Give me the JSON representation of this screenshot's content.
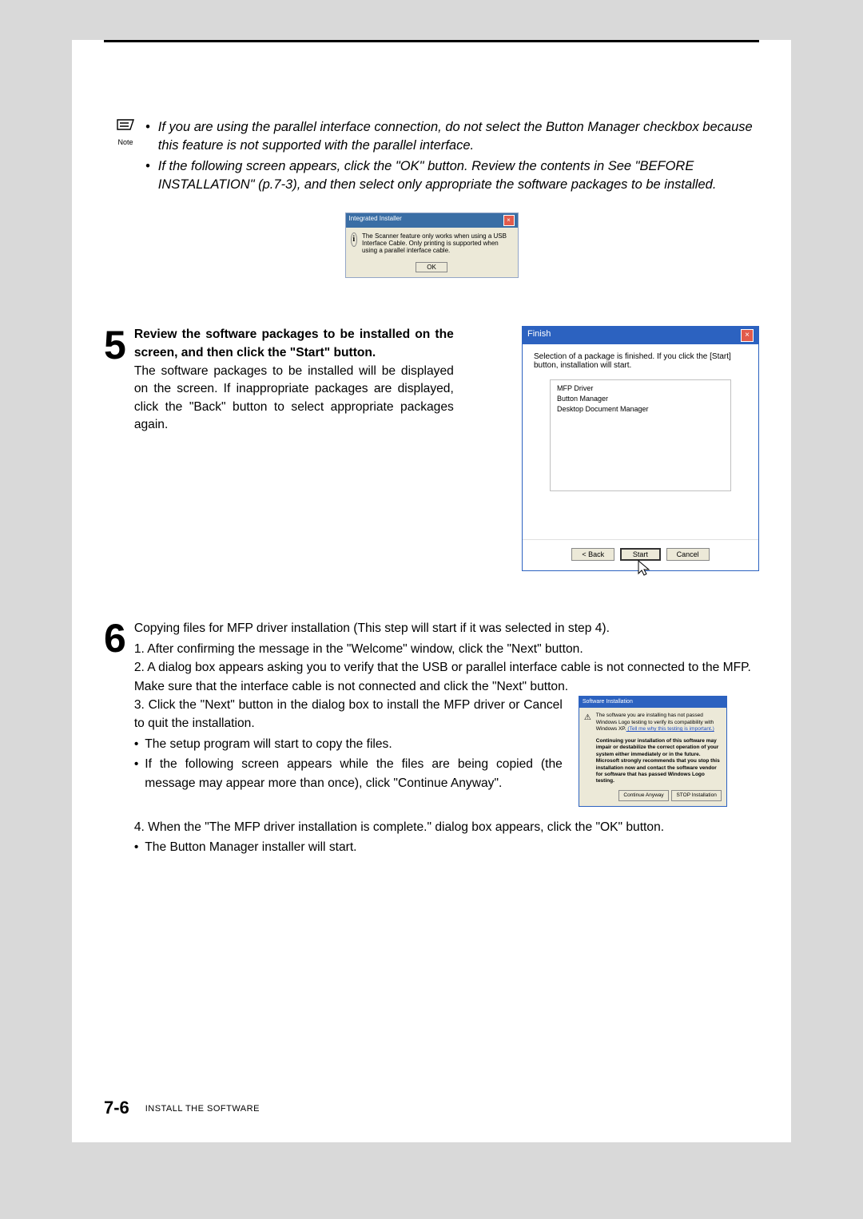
{
  "note": {
    "label": "Note",
    "bullets": [
      "If you are using the parallel interface connection, do not select the Button Manager checkbox because this feature is not supported with the parallel interface.",
      "If the following screen appears, click the \"OK\" button. Review the contents in See \"BEFORE INSTALLATION\" (p.7-3), and then select only appropriate the software packages to be installed."
    ]
  },
  "dialog1": {
    "title": "Integrated Installer",
    "msg": "The Scanner feature only works when using a USB Interface Cable. Only printing is supported when using a parallel interface cable.",
    "ok": "OK"
  },
  "step5": {
    "num": "5",
    "p1": "Review the software packages to be installed on the screen, and then click the \"Start\" button.",
    "p2": "The software packages to be installed will be displayed on the screen. If inappropriate packages are displayed, click the \"Back\" button to select appropriate packages again."
  },
  "finish": {
    "title": "Finish",
    "msg": "Selection of a package is finished. If you click the [Start] button, installation will start.",
    "items": [
      "MFP Driver",
      "Button Manager",
      "Desktop Document Manager"
    ],
    "back": "< Back",
    "start": "Start",
    "cancel": "Cancel"
  },
  "step6": {
    "num": "6",
    "lead": "Copying files for MFP driver installation (This step will start if it was selected in step 4).",
    "li1": "After confirming the message in the \"Welcome\" window, click the \"Next\" button.",
    "li2": "A dialog box appears asking you to verify that the USB or parallel interface cable is not connected to the MFP. Make sure that the interface cable is not connected and click the \"Next\" button.",
    "li3": "Click the \"Next\" button in the dialog box to install the MFP driver or Cancel to quit the installation.",
    "b1": "The setup program will start to copy the files.",
    "b2": "If the following screen appears while the files are being copied (the message may appear more than once), click \"Continue Anyway\".",
    "li4": "When the \"The MFP driver installation is complete.\" dialog box appears, click the \"OK\" button.",
    "b3": "The Button Manager installer will start."
  },
  "softdlg": {
    "title": "Software Installation",
    "l1": "The software you are installing has not passed Windows Logo testing to verify its compatibility with Windows XP.",
    "l1link": " (Tell me why this testing is important.)",
    "l2": "Continuing your installation of this software may impair or destabilize the correct operation of your system either immediately or in the future. Microsoft strongly recommends that you stop this installation now and contact the software vendor for software that has passed Windows Logo testing.",
    "cont": "Continue Anyway",
    "stop": "STOP Installation"
  },
  "footer": {
    "page": "7-6",
    "label": "INSTALL THE SOFTWARE"
  }
}
